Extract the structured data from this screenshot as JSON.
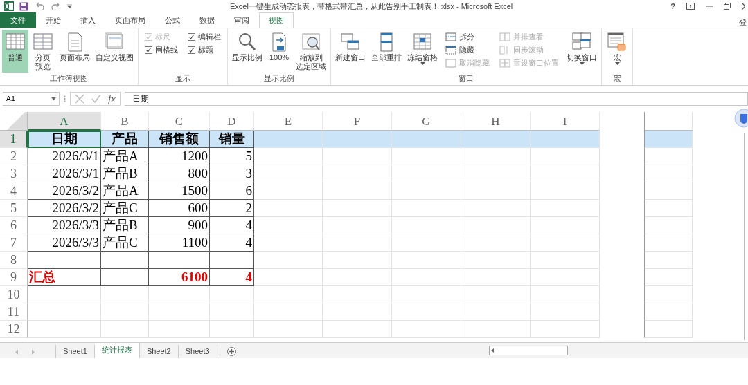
{
  "title_bar": {
    "title": "Excel一键生成动态报表，带格式带汇总，从此告别手工制表！.xlsx - Microsoft Excel",
    "help": "?"
  },
  "tabs": [
    {
      "label": "文件",
      "kind": "file",
      "selected": false
    },
    {
      "label": "开始",
      "kind": "tab",
      "selected": false
    },
    {
      "label": "插入",
      "kind": "tab",
      "selected": false
    },
    {
      "label": "页面布局",
      "kind": "tab",
      "selected": false
    },
    {
      "label": "公式",
      "kind": "tab",
      "selected": false
    },
    {
      "label": "数据",
      "kind": "tab",
      "selected": false
    },
    {
      "label": "审阅",
      "kind": "tab",
      "selected": false
    },
    {
      "label": "视图",
      "kind": "tab",
      "selected": true
    }
  ],
  "account": "登",
  "ribbon": [
    {
      "label": "工作簿视图",
      "items": [
        {
          "kind": "large",
          "label": "普通",
          "selected": true
        },
        {
          "kind": "large",
          "label": "分页预览",
          "wrap": true,
          "selected": false
        },
        {
          "kind": "large",
          "label": "页面布局",
          "selected": false
        },
        {
          "kind": "large",
          "label": "自定义视图",
          "selected": false
        }
      ]
    },
    {
      "label": "显示",
      "items": [
        {
          "kind": "stack",
          "items": [
            {
              "kind": "check",
              "label": "标尺",
              "checked": true,
              "disabled": true
            },
            {
              "kind": "check",
              "label": "网格线",
              "checked": true,
              "disabled": false
            }
          ]
        },
        {
          "kind": "stack",
          "items": [
            {
              "kind": "check",
              "label": "编辑栏",
              "checked": true,
              "disabled": false
            },
            {
              "kind": "check",
              "label": "标题",
              "checked": true,
              "disabled": false
            }
          ]
        }
      ]
    },
    {
      "label": "显示比例",
      "items": [
        {
          "kind": "large",
          "label": "显示比例"
        },
        {
          "kind": "large",
          "label": "100%"
        },
        {
          "kind": "large",
          "label": "缩放到选定区域",
          "wrap": true
        }
      ]
    },
    {
      "label": "窗口",
      "items": [
        {
          "kind": "large",
          "label": "新建窗口"
        },
        {
          "kind": "large",
          "label": "全部重排"
        },
        {
          "kind": "large",
          "label": "冻结窗格",
          "dropdown": true
        },
        {
          "kind": "stack",
          "items": [
            {
              "kind": "small",
              "label": "拆分",
              "disabled": false
            },
            {
              "kind": "small",
              "label": "隐藏",
              "disabled": false
            },
            {
              "kind": "small",
              "label": "取消隐藏",
              "disabled": true
            }
          ]
        },
        {
          "kind": "stack",
          "items": [
            {
              "kind": "small",
              "label": "并排查看",
              "disabled": true
            },
            {
              "kind": "small",
              "label": "同步滚动",
              "disabled": true
            },
            {
              "kind": "small",
              "label": "重设窗口位置",
              "disabled": true
            }
          ]
        },
        {
          "kind": "large",
          "label": "切换窗口",
          "dropdown": true
        }
      ]
    },
    {
      "label": "宏",
      "items": [
        {
          "kind": "large",
          "label": "宏",
          "dropdown": true
        }
      ]
    }
  ],
  "formula_bar": {
    "name_box": "A1",
    "fx": "fx",
    "formula": "日期"
  },
  "columns": [
    {
      "label": "A",
      "selected": true
    },
    {
      "label": "B",
      "selected": false
    },
    {
      "label": "C",
      "selected": false
    },
    {
      "label": "D",
      "selected": false
    },
    {
      "label": "E",
      "selected": false
    },
    {
      "label": "F",
      "selected": false
    },
    {
      "label": "G",
      "selected": false
    },
    {
      "label": "H",
      "selected": false
    },
    {
      "label": "I",
      "selected": false
    }
  ],
  "rows": [
    {
      "number": "1",
      "kind": "header",
      "selected": true,
      "cells": [
        "日期",
        "产品",
        "销售额",
        "销量"
      ]
    },
    {
      "number": "2",
      "kind": "data",
      "selected": false,
      "cells": [
        "2026/3/1",
        "产品A",
        "1200",
        "5"
      ]
    },
    {
      "number": "3",
      "kind": "data",
      "selected": false,
      "cells": [
        "2026/3/1",
        "产品B",
        "800",
        "3"
      ]
    },
    {
      "number": "4",
      "kind": "data",
      "selected": false,
      "cells": [
        "2026/3/2",
        "产品A",
        "1500",
        "6"
      ]
    },
    {
      "number": "5",
      "kind": "data",
      "selected": false,
      "cells": [
        "2026/3/2",
        "产品C",
        "600",
        "2"
      ]
    },
    {
      "number": "6",
      "kind": "data",
      "selected": false,
      "cells": [
        "2026/3/3",
        "产品B",
        "900",
        "4"
      ]
    },
    {
      "number": "7",
      "kind": "data",
      "selected": false,
      "cells": [
        "2026/3/3",
        "产品C",
        "1100",
        "4"
      ]
    },
    {
      "number": "8",
      "kind": "blank",
      "selected": false
    },
    {
      "number": "9",
      "kind": "total",
      "selected": false,
      "cells": [
        "汇总",
        null,
        "6100",
        "4"
      ]
    },
    {
      "number": "10",
      "kind": "empty",
      "selected": false
    },
    {
      "number": "11",
      "kind": "empty",
      "selected": false
    },
    {
      "number": "12",
      "kind": "empty",
      "selected": false
    }
  ],
  "sheet_tabs": [
    {
      "label": "Sheet1",
      "selected": false
    },
    {
      "label": "统计报表",
      "selected": true
    },
    {
      "label": "Sheet2",
      "selected": false
    },
    {
      "label": "Sheet3",
      "selected": false
    }
  ]
}
